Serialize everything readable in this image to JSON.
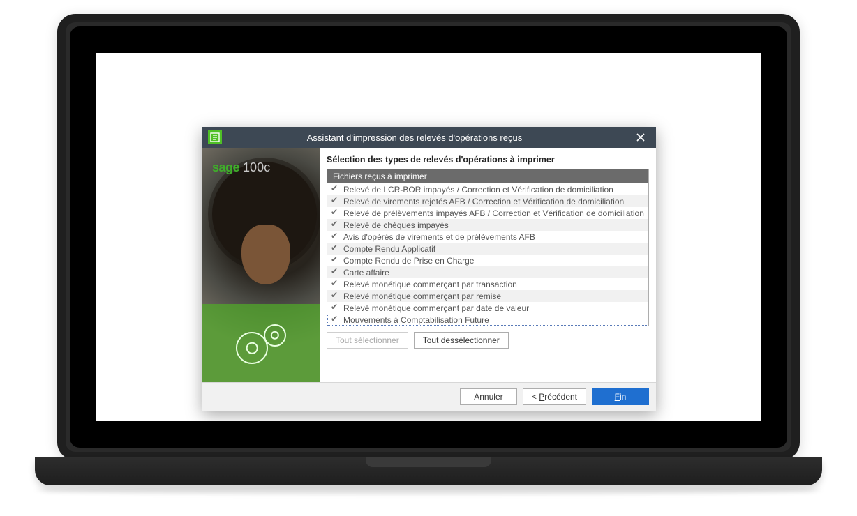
{
  "dialog": {
    "title": "Assistant d'impression des relevés d'opérations reçus",
    "close_label": "✕"
  },
  "side": {
    "brand": "sage",
    "product": "100c"
  },
  "content": {
    "section_title": "Sélection des types de relevés d'opérations à imprimer",
    "list_header": "Fichiers reçus à imprimer",
    "items": [
      "Relevé de LCR-BOR impayés / Correction et Vérification de domiciliation",
      "Relevé de virements rejetés AFB / Correction et Vérification de domiciliation",
      "Relevé de prélèvements impayés AFB / Correction et Vérification de domiciliation",
      "Relevé de chèques impayés",
      "Avis d'opérés de virements et de prélèvements AFB",
      "Compte Rendu Applicatif",
      "Compte Rendu de Prise en Charge",
      "Carte affaire",
      "Relevé monétique commerçant par transaction",
      "Relevé monétique commerçant par remise",
      "Relevé monétique commerçant par date de valeur",
      "Mouvements à Comptabilisation Future"
    ],
    "selected_index": 11,
    "select_all": {
      "pre": "T",
      "rest": "out sélectionner"
    },
    "deselect_all": {
      "pre": "T",
      "rest": "out dessélectionner"
    }
  },
  "footer": {
    "cancel": "Annuler",
    "prev": {
      "prefix": "< ",
      "ul": "P",
      "rest": "récédent"
    },
    "finish": {
      "ul": "F",
      "rest": "in"
    }
  }
}
